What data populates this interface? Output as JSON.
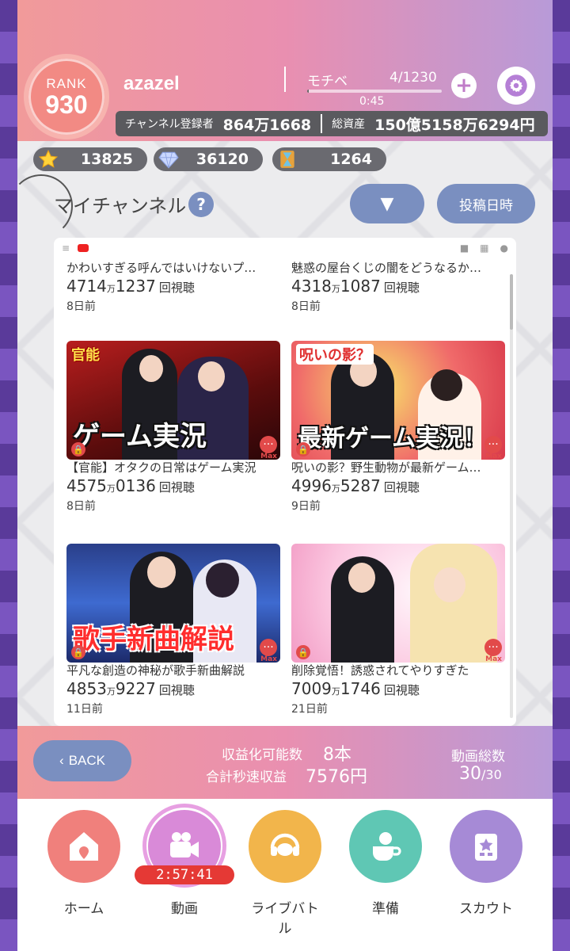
{
  "header": {
    "rank_label": "RANK",
    "rank_value": "930",
    "username": "azazel",
    "mochibe_label": "モチベ",
    "mochibe_count": "4/1230",
    "mochibe_progress": 0.0033,
    "mochibe_timer": "0:45",
    "plus_label": "+",
    "subscribers_label": "チャンネル登録者",
    "subscribers_value": "864万1668",
    "assets_label": "総資産",
    "assets_value": "150億5158万6294円"
  },
  "currencies": [
    {
      "icon": "star-icon",
      "value": "13825"
    },
    {
      "icon": "diamond-icon",
      "value": "36120"
    },
    {
      "icon": "hourglass-icon",
      "value": "1264"
    }
  ],
  "section": {
    "title": "マイチャンネル",
    "help": "?",
    "dropdown": "▼",
    "sort": "投稿日時"
  },
  "videos": [
    {
      "title": "かわいすぎる呼んではいけないプ…",
      "views_a": "4714",
      "views_b": "1237",
      "man": "万",
      "unit": "回視聴",
      "ago": "8日前"
    },
    {
      "title": "魅惑の屋台くじの闇をどうなるか…",
      "views_a": "4318",
      "views_b": "1087",
      "man": "万",
      "unit": "回視聴",
      "ago": "8日前"
    },
    {
      "title": "【官能】オタクの日常はゲーム実況",
      "views_a": "4575",
      "views_b": "0136",
      "man": "万",
      "unit": "回視聴",
      "ago": "8日前",
      "caption": "ゲーム実況",
      "tag": "官能"
    },
    {
      "title": "呪いの影？野生動物が最新ゲーム…",
      "views_a": "4996",
      "views_b": "5287",
      "man": "万",
      "unit": "回視聴",
      "ago": "9日前",
      "caption": "最新ゲーム実況！",
      "tag": "呪いの影？"
    },
    {
      "title": "平凡な創造の神秘が歌手新曲解説",
      "views_a": "4853",
      "views_b": "9227",
      "man": "万",
      "unit": "回視聴",
      "ago": "11日前",
      "caption": "歌手新曲解説"
    },
    {
      "title": "削除覚悟！誘惑されてやりすぎた",
      "views_a": "7009",
      "views_b": "1746",
      "man": "万",
      "unit": "回視聴",
      "ago": "21日前"
    }
  ],
  "thumb_badges": {
    "more": "···",
    "max": "Max",
    "lock": "🔒"
  },
  "footer": {
    "back": "BACK",
    "monetizable_label": "収益化可能数",
    "monetizable_value": "8本",
    "per_sec_label": "合計秒速収益",
    "per_sec_value": "7576円",
    "total_label": "動画総数",
    "total_value": "30",
    "total_max": "/30"
  },
  "nav": [
    {
      "label": "ホーム",
      "color": "#f0807c",
      "icon": "house-icon"
    },
    {
      "label": "動画",
      "color": "#d98ad8",
      "icon": "video-camera-icon"
    },
    {
      "label": "ライブバトル",
      "color": "#f2b54b",
      "icon": "headset-icon"
    },
    {
      "label": "準備",
      "color": "#5fc7b4",
      "icon": "coffee-icon"
    },
    {
      "label": "スカウト",
      "color": "#a68ad6",
      "icon": "scout-icon"
    }
  ],
  "nav_timer": "2:57:41"
}
